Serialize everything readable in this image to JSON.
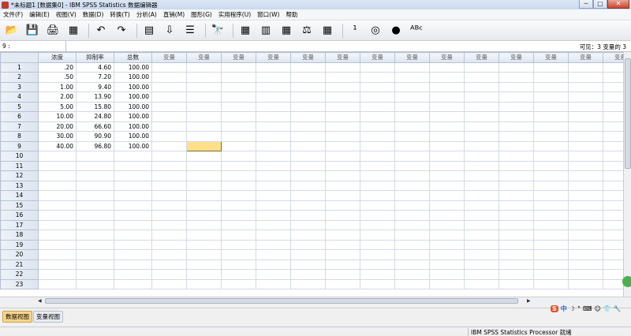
{
  "window": {
    "title": "*未标题1 [数据集0] - IBM SPSS Statistics 数据编辑器",
    "controls": [
      "─",
      "□",
      "✕"
    ]
  },
  "menu": [
    "文件(F)",
    "编辑(E)",
    "视图(V)",
    "数据(D)",
    "转换(T)",
    "分析(A)",
    "直销(M)",
    "图形(G)",
    "实用程序(U)",
    "窗口(W)",
    "帮助"
  ],
  "toolbar": {
    "buttons": [
      {
        "name": "open-file-icon",
        "glyph": "📂"
      },
      {
        "name": "save-icon",
        "glyph": "💾"
      },
      {
        "name": "print-icon",
        "glyph": "🖨"
      },
      {
        "name": "dialog-recall-icon",
        "glyph": "▦"
      },
      {
        "name": "undo-icon",
        "glyph": "↶"
      },
      {
        "name": "redo-icon",
        "glyph": "↷"
      },
      {
        "name": "goto-case-icon",
        "glyph": "▤"
      },
      {
        "name": "goto-variable-icon",
        "glyph": "⇩"
      },
      {
        "name": "variables-icon",
        "glyph": "☰"
      },
      {
        "name": "find-icon",
        "glyph": "🔭"
      },
      {
        "name": "insert-cases-icon",
        "glyph": "▦"
      },
      {
        "name": "insert-variable-icon",
        "glyph": "▥"
      },
      {
        "name": "split-file-icon",
        "glyph": "▦"
      },
      {
        "name": "weight-cases-icon",
        "glyph": "⚖"
      },
      {
        "name": "select-cases-icon",
        "glyph": "▦"
      },
      {
        "name": "value-labels-icon",
        "glyph": "¹"
      },
      {
        "name": "use-sets-icon",
        "glyph": "◎"
      },
      {
        "name": "show-all-variables-icon",
        "glyph": "●"
      },
      {
        "name": "spelling-icon",
        "glyph": "ᴬᴮᶜ"
      }
    ]
  },
  "cellref": {
    "ref": "9 :",
    "visible": "可见：3 变量的 3"
  },
  "grid": {
    "columns": [
      "浓度",
      "抑制率",
      "总数",
      "变量",
      "变量",
      "变量",
      "变量",
      "变量",
      "变量",
      "变量",
      "变量",
      "变量",
      "变量",
      "变量",
      "变量",
      "变量",
      "变量",
      "变"
    ],
    "rows": [
      {
        "n": "1",
        "c1": ".20",
        "c2": "4.60",
        "c3": "100.00"
      },
      {
        "n": "2",
        "c1": ".50",
        "c2": "7.20",
        "c3": "100.00"
      },
      {
        "n": "3",
        "c1": "1.00",
        "c2": "9.40",
        "c3": "100.00"
      },
      {
        "n": "4",
        "c1": "2.00",
        "c2": "13.90",
        "c3": "100.00"
      },
      {
        "n": "5",
        "c1": "5.00",
        "c2": "15.80",
        "c3": "100.00"
      },
      {
        "n": "6",
        "c1": "10.00",
        "c2": "24.80",
        "c3": "100.00"
      },
      {
        "n": "7",
        "c1": "20.00",
        "c2": "66.60",
        "c3": "100.00"
      },
      {
        "n": "8",
        "c1": "30.00",
        "c2": "90.90",
        "c3": "100.00"
      },
      {
        "n": "9",
        "c1": "40.00",
        "c2": "96.80",
        "c3": "100.00"
      },
      {
        "n": "10",
        "c1": "",
        "c2": "",
        "c3": ""
      },
      {
        "n": "11",
        "c1": "",
        "c2": "",
        "c3": ""
      },
      {
        "n": "12",
        "c1": "",
        "c2": "",
        "c3": ""
      },
      {
        "n": "13",
        "c1": "",
        "c2": "",
        "c3": ""
      },
      {
        "n": "14",
        "c1": "",
        "c2": "",
        "c3": ""
      },
      {
        "n": "15",
        "c1": "",
        "c2": "",
        "c3": ""
      },
      {
        "n": "16",
        "c1": "",
        "c2": "",
        "c3": ""
      },
      {
        "n": "17",
        "c1": "",
        "c2": "",
        "c3": ""
      },
      {
        "n": "18",
        "c1": "",
        "c2": "",
        "c3": ""
      },
      {
        "n": "19",
        "c1": "",
        "c2": "",
        "c3": ""
      },
      {
        "n": "20",
        "c1": "",
        "c2": "",
        "c3": ""
      },
      {
        "n": "21",
        "c1": "",
        "c2": "",
        "c3": ""
      },
      {
        "n": "22",
        "c1": "",
        "c2": "",
        "c3": ""
      },
      {
        "n": "23",
        "c1": "",
        "c2": "",
        "c3": ""
      }
    ],
    "selected_row": 9,
    "selected_col": 5
  },
  "tabs": {
    "data_view": "数据视图",
    "variable_view": "变量视图"
  },
  "status": {
    "processor": "IBM SPSS Statistics Processor 就绪"
  },
  "ime": {
    "logo": "S",
    "mode": "中"
  },
  "colors": {
    "selected_cell": "#ffe08a",
    "active_tab": "#f8d58a"
  }
}
